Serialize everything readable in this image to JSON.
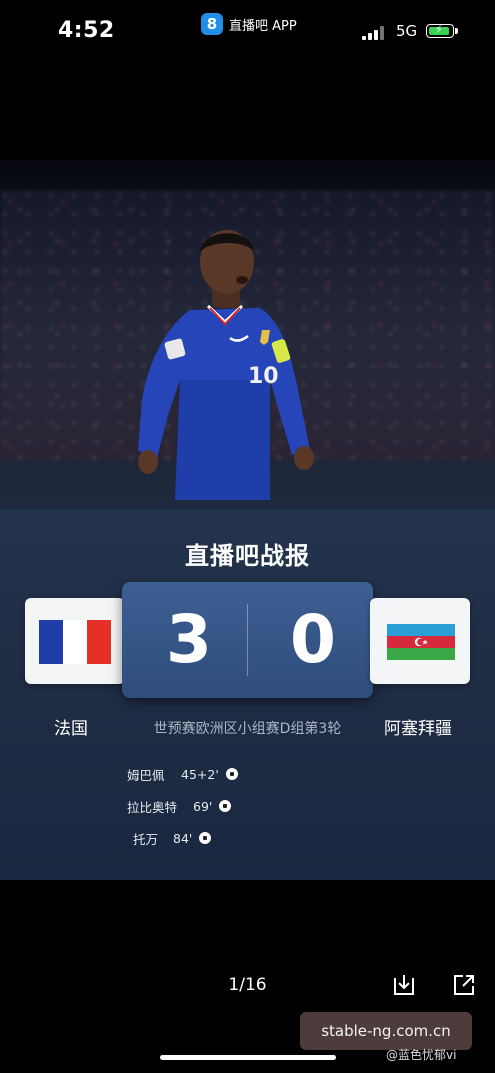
{
  "status_bar": {
    "time": "4:52",
    "app_logo": "8",
    "app_name": "直播吧 APP",
    "network": "5G",
    "battery_charging": true
  },
  "card": {
    "headline": "直播吧战报",
    "home_team": "法国",
    "away_team": "阿塞拜疆",
    "home_score": "3",
    "away_score": "0",
    "competition": "世预赛欧洲区小组赛D组第3轮",
    "scorers": [
      {
        "name": "姆巴佩",
        "minute": "45+2'"
      },
      {
        "name": "拉比奥特",
        "minute": "69'"
      },
      {
        "name": "托万",
        "minute": "84'"
      }
    ],
    "colors": {
      "france_blue": "#1f3ea8",
      "france_red": "#e63027",
      "azerbaijan_blue": "#2a9fd6",
      "azerbaijan_red": "#d62a3c",
      "azerbaijan_green": "#3aa847"
    }
  },
  "viewer": {
    "pager": "1/16",
    "download_icon": "download-icon",
    "share_icon": "share-icon"
  },
  "overlay": {
    "watermark": "stable-ng.com.cn",
    "credit": "@蓝色忧郁vi"
  }
}
